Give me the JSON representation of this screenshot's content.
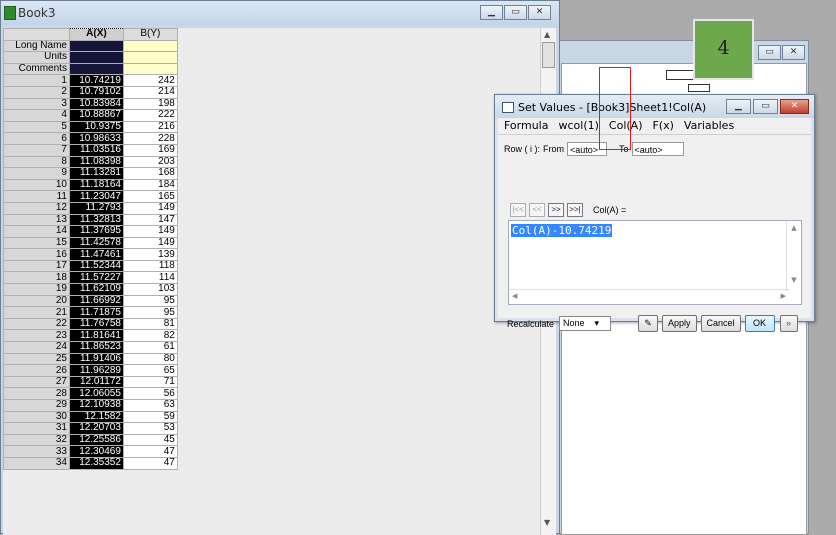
{
  "book": {
    "title": "Book3",
    "columns": [
      {
        "header": "A(X)"
      },
      {
        "header": "B(Y)"
      }
    ],
    "meta_rows": [
      "Long Name",
      "Units",
      "Comments"
    ],
    "rows": [
      {
        "n": "1",
        "a": "10.74219",
        "b": "242"
      },
      {
        "n": "2",
        "a": "10.79102",
        "b": "214"
      },
      {
        "n": "3",
        "a": "10.83984",
        "b": "198"
      },
      {
        "n": "4",
        "a": "10.88867",
        "b": "222"
      },
      {
        "n": "5",
        "a": "10.9375",
        "b": "216"
      },
      {
        "n": "6",
        "a": "10.98633",
        "b": "228"
      },
      {
        "n": "7",
        "a": "11.03516",
        "b": "169"
      },
      {
        "n": "8",
        "a": "11.08398",
        "b": "203"
      },
      {
        "n": "9",
        "a": "11.13281",
        "b": "168"
      },
      {
        "n": "10",
        "a": "11.18164",
        "b": "184"
      },
      {
        "n": "11",
        "a": "11.23047",
        "b": "165"
      },
      {
        "n": "12",
        "a": "11.2793",
        "b": "149"
      },
      {
        "n": "13",
        "a": "11.32813",
        "b": "147"
      },
      {
        "n": "14",
        "a": "11.37695",
        "b": "149"
      },
      {
        "n": "15",
        "a": "11.42578",
        "b": "149"
      },
      {
        "n": "16",
        "a": "11.47461",
        "b": "139"
      },
      {
        "n": "17",
        "a": "11.52344",
        "b": "118"
      },
      {
        "n": "18",
        "a": "11.57227",
        "b": "114"
      },
      {
        "n": "19",
        "a": "11.62109",
        "b": "103"
      },
      {
        "n": "20",
        "a": "11.66992",
        "b": "95"
      },
      {
        "n": "21",
        "a": "11.71875",
        "b": "95"
      },
      {
        "n": "22",
        "a": "11.76758",
        "b": "81"
      },
      {
        "n": "23",
        "a": "11.81641",
        "b": "82"
      },
      {
        "n": "24",
        "a": "11.86523",
        "b": "61"
      },
      {
        "n": "25",
        "a": "11.91406",
        "b": "80"
      },
      {
        "n": "26",
        "a": "11.96289",
        "b": "65"
      },
      {
        "n": "27",
        "a": "12.01172",
        "b": "71"
      },
      {
        "n": "28",
        "a": "12.06055",
        "b": "56"
      },
      {
        "n": "29",
        "a": "12.10938",
        "b": "63"
      },
      {
        "n": "30",
        "a": "12.1582",
        "b": "59"
      },
      {
        "n": "31",
        "a": "12.20703",
        "b": "53"
      },
      {
        "n": "32",
        "a": "12.25586",
        "b": "45"
      },
      {
        "n": "33",
        "a": "12.30469",
        "b": "47"
      },
      {
        "n": "34",
        "a": "12.35352",
        "b": "47"
      }
    ]
  },
  "marker": {
    "label": "4"
  },
  "dialog": {
    "title": "Set Values - [Book3]Sheet1!Col(A)",
    "menu": [
      "Formula",
      "wcol(1)",
      "Col(A)",
      "F(x)",
      "Variables"
    ],
    "row_label": "Row ( i ):",
    "from_label": "From",
    "from_value": "<auto>",
    "to_label": "To",
    "to_value": "<auto>",
    "nav_buttons": [
      "|<<",
      "<<",
      ">>",
      ">>|"
    ],
    "col_label": "Col(A) =",
    "formula": "Col(A)-10.74219",
    "recalculate_label": "Recalculate",
    "recalculate_value": "None",
    "apply_label": "Apply",
    "cancel_label": "Cancel",
    "ok_label": "OK",
    "expand_label": "»"
  },
  "colors": {
    "selected_column_bg": "#000000",
    "meta_row_bg": "#fefecb",
    "marker_green": "#6ea84c",
    "highlight_red": "#e01818"
  }
}
